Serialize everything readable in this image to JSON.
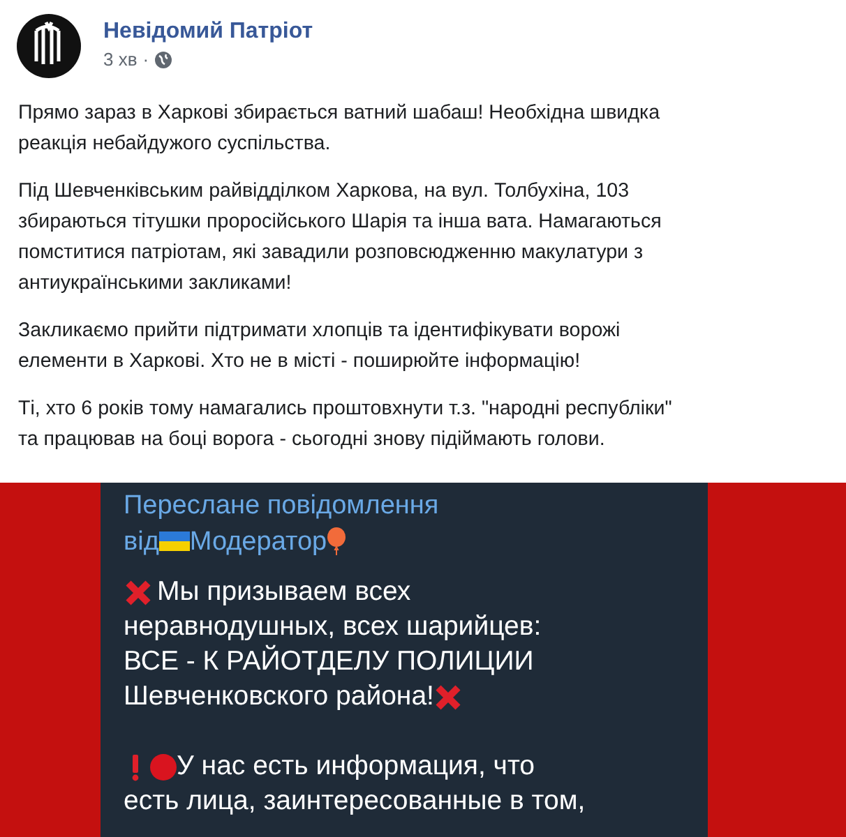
{
  "post": {
    "author": "Невідомий Патріот",
    "time": "3 хв",
    "separator": "·",
    "paragraphs": [
      [
        "Прямо зараз в Харкові збирається ватний шабаш! Необхідна швидка",
        "реакція небайдужого суспільства."
      ],
      [
        "Під Шевченківським райвідділком Харкова, на вул. Толбухіна, 103",
        "збираються тітушки проросійського Шарія та інша вата. Намагаються",
        "помститися патріотам, які завадили розповсюдженню макулатури з",
        "антиукраїнськими закликами!"
      ],
      [
        "Закликаємо прийти підтримати хлопців та ідентифікувати ворожі",
        "елементи в Харкові. Хто не в місті - поширюйте інформацію!"
      ],
      [
        "Ті, хто 6 років тому намагались проштовхнути т.з. \"народні республіки\"",
        "та працював на боці ворога - сьогодні знову підіймають голови."
      ]
    ]
  },
  "attachment": {
    "forwarded_label": "Переслане повідомлення",
    "from_prefix": "від",
    "from_name": "Модератор",
    "messages": [
      {
        "kind": "cross",
        "lines": [
          "Мы призываем всех",
          "неравнодушных, всех шарийцев:",
          "ВСЕ - К РАЙОТДЕЛУ ПОЛИЦИИ",
          "Шевченковского района!"
        ]
      },
      {
        "kind": "alert",
        "lines": [
          "У нас есть информация, что",
          "есть лица, заинтересованные в том,"
        ]
      }
    ]
  }
}
